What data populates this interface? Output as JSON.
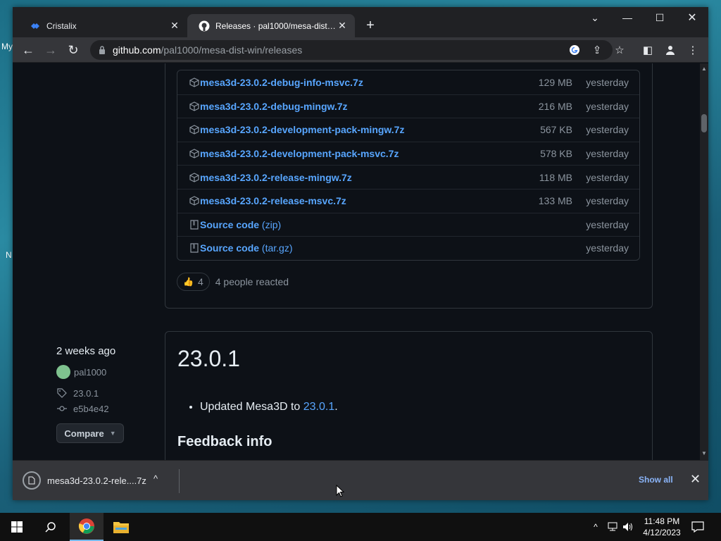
{
  "desktop": {
    "edge_labels": [
      "My",
      "N"
    ]
  },
  "browser": {
    "tabs": [
      {
        "title": "Cristalix",
        "icon": "cristalix-logo-icon"
      },
      {
        "title": "Releases · pal1000/mesa-dist-win",
        "icon": "github-icon"
      }
    ],
    "url_domain": "github.com",
    "url_path": "/pal1000/mesa-dist-win/releases"
  },
  "assets": [
    {
      "name": "mesa3d-23.0.2-debug-info-msvc.7z",
      "size": "129 MB",
      "date": "yesterday",
      "type": "package"
    },
    {
      "name": "mesa3d-23.0.2-debug-mingw.7z",
      "size": "216 MB",
      "date": "yesterday",
      "type": "package"
    },
    {
      "name": "mesa3d-23.0.2-development-pack-mingw.7z",
      "size": "567 KB",
      "date": "yesterday",
      "type": "package"
    },
    {
      "name": "mesa3d-23.0.2-development-pack-msvc.7z",
      "size": "578 KB",
      "date": "yesterday",
      "type": "package"
    },
    {
      "name": "mesa3d-23.0.2-release-mingw.7z",
      "size": "118 MB",
      "date": "yesterday",
      "type": "package"
    },
    {
      "name": "mesa3d-23.0.2-release-msvc.7z",
      "size": "133 MB",
      "date": "yesterday",
      "type": "package"
    },
    {
      "name": "Source code",
      "suffix": "(zip)",
      "size": "",
      "date": "yesterday",
      "type": "source"
    },
    {
      "name": "Source code",
      "suffix": "(tar.gz)",
      "size": "",
      "date": "yesterday",
      "type": "source"
    }
  ],
  "reaction": {
    "emoji": "👍",
    "count": "4",
    "text": "4 people reacted"
  },
  "release_meta": {
    "date": "2 weeks ago",
    "author": "pal1000",
    "tag": "23.0.1",
    "commit": "e5b4e42",
    "compare_label": "Compare"
  },
  "release": {
    "title": "23.0.1",
    "bullet_prefix": "Updated Mesa3D to ",
    "bullet_link": "23.0.1",
    "bullet_suffix": ".",
    "feedback_heading": "Feedback info"
  },
  "download_shelf": {
    "file_name": "mesa3d-23.0.2-rele....7z",
    "show_all_label": "Show all"
  },
  "taskbar": {
    "time": "11:48 PM",
    "date": "4/12/2023"
  }
}
